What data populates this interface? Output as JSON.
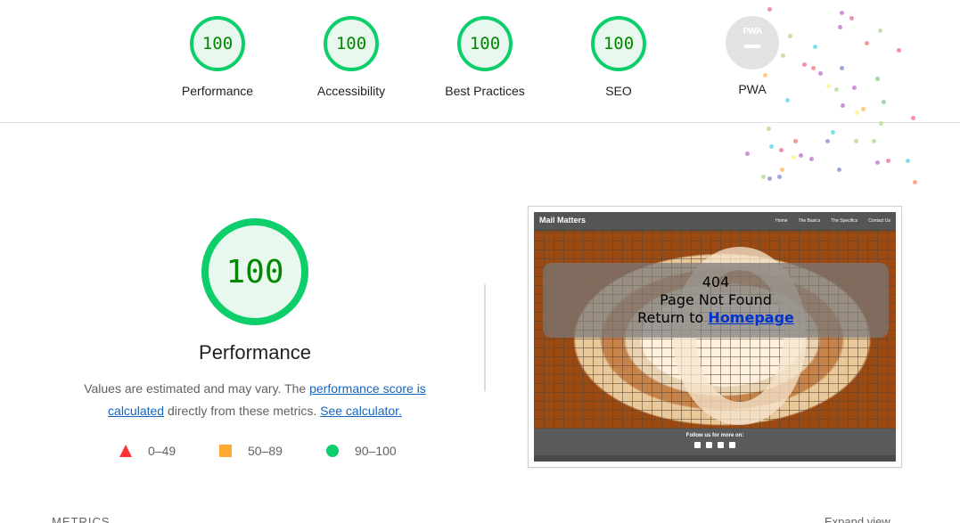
{
  "categories": [
    {
      "label": "Performance",
      "score": "100"
    },
    {
      "label": "Accessibility",
      "score": "100"
    },
    {
      "label": "Best Practices",
      "score": "100"
    },
    {
      "label": "SEO",
      "score": "100"
    }
  ],
  "pwa": {
    "label": "PWA",
    "badge_text": "PWA"
  },
  "main": {
    "score": "100",
    "title": "Performance",
    "desc_prefix": "Values are estimated and may vary. The ",
    "desc_link1": "performance score is calculated",
    "desc_middle": " directly from these metrics. ",
    "desc_link2": "See calculator.",
    "legend": [
      "0–49",
      "50–89",
      "90–100"
    ]
  },
  "screenshot": {
    "brand": "Mail Matters",
    "nav_links": [
      "Home",
      "The Basics",
      "The Specifics",
      "Contact Us"
    ],
    "error_code": "404",
    "error_text": "Page Not Found",
    "return_prefix": "Return to ",
    "return_link": "Homepage",
    "footer_text": "Follow us for more on:"
  },
  "sections": {
    "metrics": "METRICS",
    "expand": "Expand view"
  },
  "colors": {
    "pass": "#0cce6b",
    "pass_text": "#008800",
    "average": "#ffaa33",
    "fail": "#ff3333",
    "link": "#1565c0"
  }
}
